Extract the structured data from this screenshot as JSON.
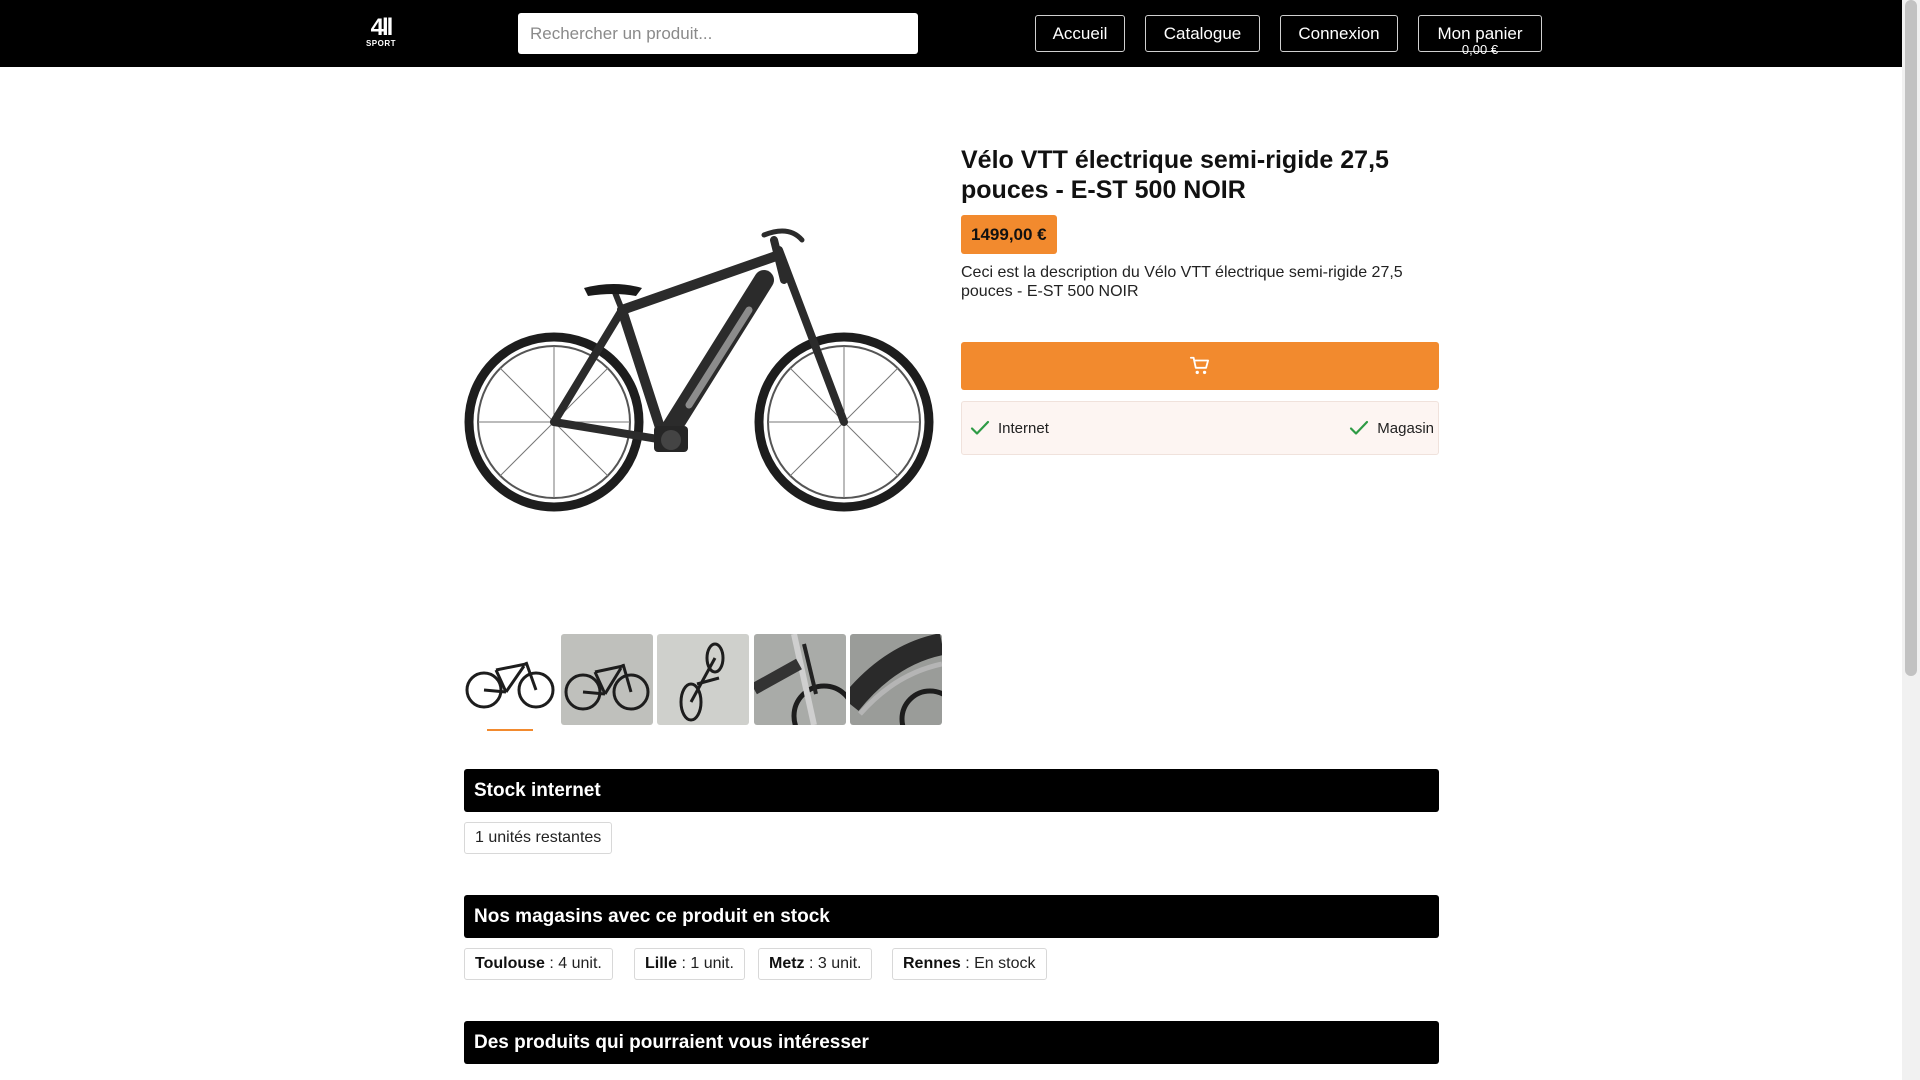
{
  "header": {
    "logo_main": "4ll",
    "logo_sub": "SPORT",
    "search_placeholder": "Rechercher un produit...",
    "nav": {
      "home": "Accueil",
      "catalog": "Catalogue",
      "login": "Connexion",
      "cart": "Mon panier",
      "cart_total": "0,00 €"
    }
  },
  "product": {
    "title": "Vélo VTT électrique semi-rigide 27,5 pouces - E-ST 500 NOIR",
    "price": "1499,00 €",
    "description": "Ceci est la description du Vélo VTT électrique semi-rigide 27,5 pouces - E-ST 500 NOIR",
    "add_to_cart_icon": "cart-icon",
    "thumbnails_count": 5,
    "active_thumbnail": 1,
    "availability": {
      "internet": "Internet",
      "store": "Magasin"
    }
  },
  "stock_internet": {
    "heading": "Stock internet",
    "units_remaining": "1 unités restantes"
  },
  "stores": {
    "heading": "Nos magasins avec ce produit en stock",
    "items": [
      {
        "city": "Toulouse",
        "stock": " : 4 unit."
      },
      {
        "city": "Lille",
        "stock": " : 1 unit."
      },
      {
        "city": "Metz",
        "stock": " : 3 unit."
      },
      {
        "city": "Rennes",
        "stock": " : En stock"
      }
    ]
  },
  "related": {
    "heading": "Des produits qui pourraient vous intéresser"
  },
  "colors": {
    "accent": "#f28a2e",
    "header_bg": "#000000",
    "availability_bg": "#fdf5f2",
    "check": "#2e9b45"
  }
}
